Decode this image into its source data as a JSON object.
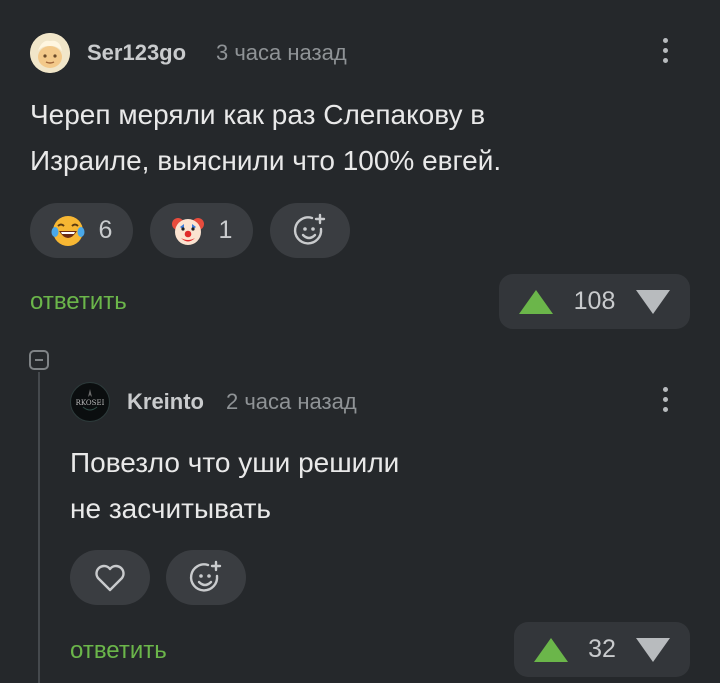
{
  "comments": [
    {
      "author": "Ser123go",
      "time": "3 часа назад",
      "text_lines": [
        "Череп меряли как раз Слепакову в",
        "Израиле, выяснили что 100% евгей."
      ],
      "reactions": [
        {
          "icon": "laughing-tears-emoji-icon",
          "count": "6"
        },
        {
          "icon": "clown-face-emoji-icon",
          "count": "1"
        }
      ],
      "add_reaction_icon": "add-reaction-icon",
      "reply_label": "ответить",
      "rating": "108"
    },
    {
      "author": "Kreinto",
      "avatar_text": "RKOSEI",
      "time": "2 часа назад",
      "text_lines": [
        "Повезло что уши решили",
        "не засчитывать"
      ],
      "like_icon": "heart-icon",
      "add_reaction_icon": "add-reaction-icon",
      "reply_label": "ответить",
      "rating": "32"
    }
  ],
  "colors": {
    "background": "#25282b",
    "accent_green": "#6bb64a",
    "pill_bg": "#3a3d41",
    "text_primary": "#e9e9e9",
    "text_muted": "#8f9396"
  }
}
